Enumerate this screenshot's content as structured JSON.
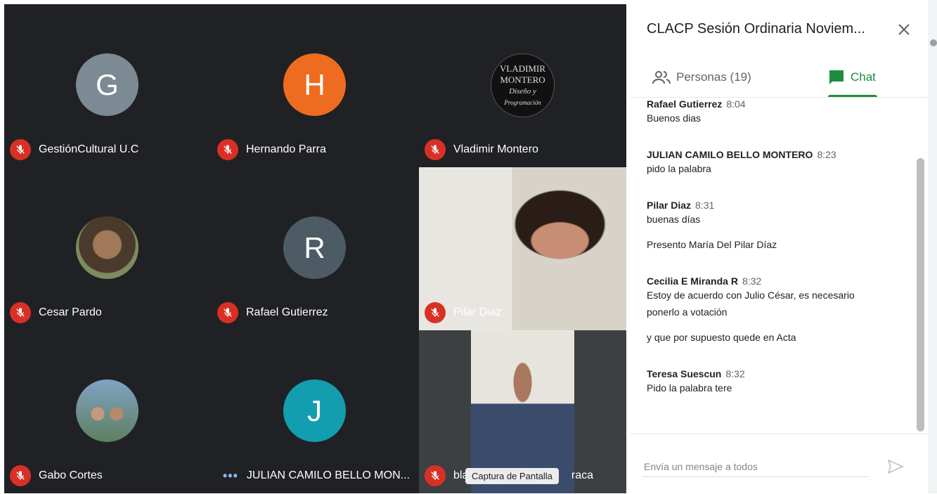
{
  "participants": [
    {
      "name": "GestiónCultural U.C",
      "initial": "G",
      "color": "#7b8a93",
      "status": "muted"
    },
    {
      "name": "Hernando Parra",
      "initial": "H",
      "color": "#ee6c1f",
      "status": "muted"
    },
    {
      "name": "Vladimir Montero",
      "logo_lines": [
        "VLADIMIR",
        "MONTERO",
        "Diseño y",
        "Programación"
      ],
      "status": "muted"
    },
    {
      "name": "Cesar Pardo",
      "status": "muted"
    },
    {
      "name": "Rafael Gutierrez",
      "initial": "R",
      "color": "#4d5b64",
      "status": "muted"
    },
    {
      "name": "Pilar Diaz",
      "status": "muted"
    },
    {
      "name": "Gabo Cortes",
      "status": "muted"
    },
    {
      "name": "JULIAN CAMILO BELLO MON...",
      "initial": "J",
      "color": "#129eaf",
      "status": "speaking"
    },
    {
      "name": "bla",
      "name_suffix": "raca",
      "status": "muted"
    }
  ],
  "tooltip": "Captura de Pantalla",
  "panel": {
    "title": "CLACP Sesión Ordinaria Noviem...",
    "tabs": {
      "people": "Personas (19)",
      "chat": "Chat"
    },
    "messages": [
      {
        "author": "Rafael Gutierrez",
        "time": "8:04",
        "lines": [
          "Buenos dias"
        ]
      },
      {
        "author": "JULIAN CAMILO BELLO MONTERO",
        "time": "8:23",
        "lines": [
          "pido la palabra"
        ]
      },
      {
        "author": "Pilar Diaz",
        "time": "8:31",
        "lines": [
          "buenas días",
          "Presento María Del Pilar Díaz"
        ]
      },
      {
        "author": "Cecilia E Miranda R",
        "time": "8:32",
        "lines": [
          "Estoy de acuerdo con Julio César, es necesario ponerlo a votación",
          "y que por supuesto quede en Acta"
        ]
      },
      {
        "author": "Teresa Suescun",
        "time": "8:32",
        "lines": [
          "Pido la palabra tere"
        ]
      }
    ],
    "input_placeholder": "Envía un mensaje a todos"
  },
  "colors": {
    "mic_muted": "#d93025",
    "chat_accent": "#1e8e3e",
    "grid_bg": "#202124"
  }
}
